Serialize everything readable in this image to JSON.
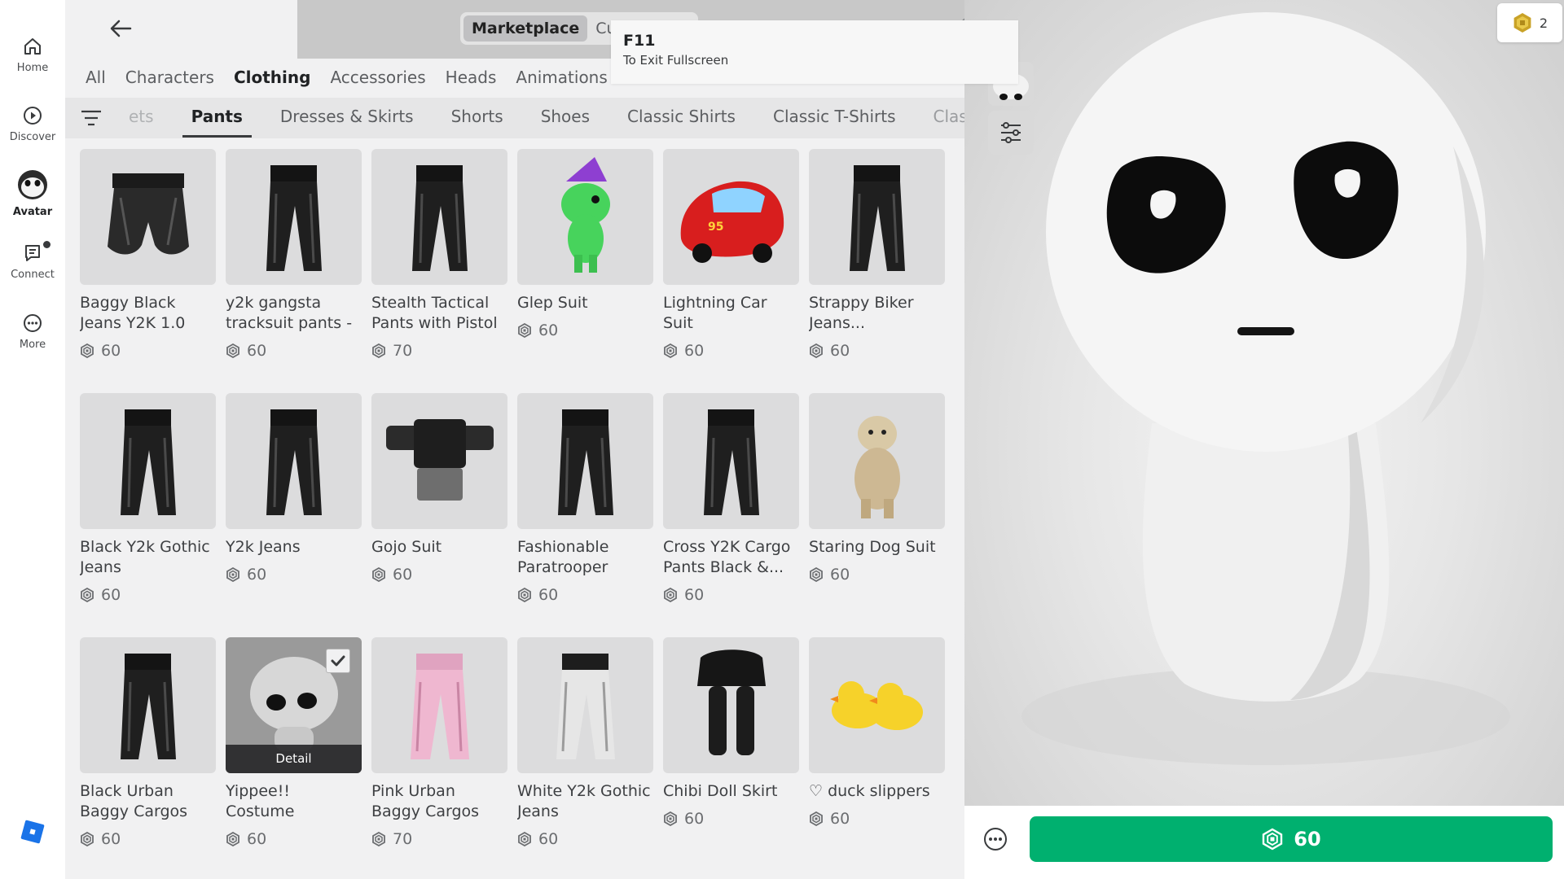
{
  "nav": {
    "items": [
      {
        "label": "Home",
        "icon": "home-icon"
      },
      {
        "label": "Discover",
        "icon": "play-circle-icon"
      },
      {
        "label": "Avatar",
        "icon": "avatar-icon"
      },
      {
        "label": "Connect",
        "icon": "chat-icon"
      },
      {
        "label": "More",
        "icon": "more-icon"
      }
    ],
    "logo": "roblox-logo"
  },
  "header": {
    "segments": [
      "Marketplace",
      "Customize"
    ],
    "active_segment": "Marketplace"
  },
  "toast": {
    "key": "F11",
    "message": "To Exit Fullscreen"
  },
  "category_tabs": [
    "All",
    "Characters",
    "Clothing",
    "Accessories",
    "Heads",
    "Animations"
  ],
  "active_category": "Clothing",
  "sub_tabs": [
    "ets",
    "Pants",
    "Dresses & Skirts",
    "Shorts",
    "Shoes",
    "Classic Shirts",
    "Classic T-Shirts",
    "Classic Pa"
  ],
  "active_sub_tab": "Pants",
  "items": [
    {
      "name": "Baggy Black Jeans Y2K 1.0",
      "price": "60",
      "kind": "jeans"
    },
    {
      "name": "y2k gangsta tracksuit pants -",
      "price": "60",
      "kind": "pants"
    },
    {
      "name": "Stealth Tactical Pants with Pistol",
      "price": "70",
      "kind": "pants"
    },
    {
      "name": "Glep Suit",
      "price": "60",
      "kind": "glep"
    },
    {
      "name": "Lightning Car Suit",
      "price": "60",
      "kind": "car"
    },
    {
      "name": "Strappy Biker Jeans...",
      "price": "60",
      "kind": "pants"
    },
    {
      "name": "Black Y2k Gothic Jeans",
      "price": "60",
      "kind": "pants"
    },
    {
      "name": "Y2k Jeans",
      "price": "60",
      "kind": "pants"
    },
    {
      "name": "Gojo Suit",
      "price": "60",
      "kind": "gojo"
    },
    {
      "name": "Fashionable Paratrooper",
      "price": "60",
      "kind": "pants"
    },
    {
      "name": "Cross Y2K Cargo Pants Black &...",
      "price": "60",
      "kind": "pants"
    },
    {
      "name": "Staring Dog Suit",
      "price": "60",
      "kind": "dog"
    },
    {
      "name": "Black Urban Baggy Cargos",
      "price": "60",
      "kind": "pants"
    },
    {
      "name": "Yippee!! Costume",
      "price": "60",
      "kind": "yippee",
      "detail_label": "Detail",
      "selected": true
    },
    {
      "name": "Pink Urban Baggy Cargos",
      "price": "70",
      "kind": "pink"
    },
    {
      "name": "White Y2k Gothic Jeans",
      "price": "60",
      "kind": "white"
    },
    {
      "name": "Chibi Doll Skirt",
      "price": "60",
      "kind": "skirt"
    },
    {
      "name": "♡ duck slippers",
      "price": "60",
      "kind": "duck"
    }
  ],
  "robux_balance": "2",
  "buy_button": {
    "price": "60"
  },
  "colors": {
    "buy_green": "#00b06f",
    "panel_bg": "#f1f1f2",
    "tile_bg": "#dcdcdd"
  }
}
